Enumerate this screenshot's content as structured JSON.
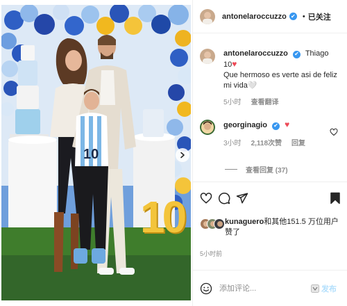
{
  "header": {
    "username": "antonelaroccuzzo",
    "verified_glyph": "✔",
    "separator": "•",
    "follow_state": "已关注"
  },
  "caption": {
    "username": "antonelaroccuzzo",
    "text": "Thiago 10",
    "heart": "♥",
    "line2": "Que hermoso es verte asi de feliz mi vida🤍",
    "time": "5小时",
    "translate": "查看翻译"
  },
  "comment": {
    "username": "georginagio",
    "heart": "♥",
    "time": "3小时",
    "likes": "2,118次赞",
    "reply": "回复",
    "view_replies": "查看回复 (37)"
  },
  "likes": {
    "username": "kunaguero",
    "text": "和其他151.5 万位用户赞了"
  },
  "post_time": "5小时前",
  "compose": {
    "placeholder": "添加评论...",
    "post_label": "发布"
  },
  "photo": {
    "jersey_number": "10",
    "big_number": "10"
  },
  "icons": {
    "like": "heart-icon",
    "comment": "comment-icon",
    "share": "share-icon",
    "save": "bookmark-icon",
    "emoji": "emoji-icon",
    "next": "chevron-right-icon"
  },
  "colors": {
    "verified": "#3897f0",
    "like_red": "#ed4956",
    "post_button": "#b2dffc",
    "muted": "#8e8e8e"
  }
}
